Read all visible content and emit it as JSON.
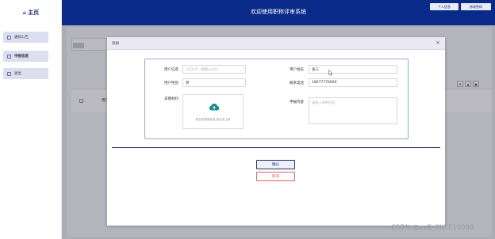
{
  "sidebar": {
    "logo": "主页",
    "items": [
      {
        "label": "通知公告",
        "icon": "notice-icon"
      },
      {
        "label": "申报信息",
        "icon": "apply-icon"
      },
      {
        "label": "退出",
        "icon": "exit-icon"
      }
    ]
  },
  "header": {
    "title": "欢迎使用职称评审系统",
    "buttons": [
      "个人信息",
      "修改密码"
    ]
  },
  "background": {
    "table_header": "用户信"
  },
  "dialog": {
    "title": "添加",
    "close": "×",
    "fields": {
      "user_account": {
        "label": "用户信息",
        "placeholder": "(1)2(3)--请输入(4)1"
      },
      "user_name": {
        "label": "用户姓名",
        "value": "张三"
      },
      "user_gender": {
        "label": "用户性别",
        "value": "男"
      },
      "phone": {
        "label": "联系电话",
        "value": "18977776666"
      },
      "materials": {
        "label": "支撑材料",
        "upload_hint": "将文件拖到此处,或点击上传"
      },
      "content": {
        "label": "申报内容",
        "placeholder": "请输入申报内容"
      }
    },
    "confirm": "确认",
    "cancel": "取消"
  },
  "watermark": "CSDN @vx2_CKKF10088",
  "colors": {
    "header": "#0a2a8a",
    "accent": "#1f2d6e",
    "cancel": "#e06060",
    "upload_icon": "#1a8f8a"
  }
}
